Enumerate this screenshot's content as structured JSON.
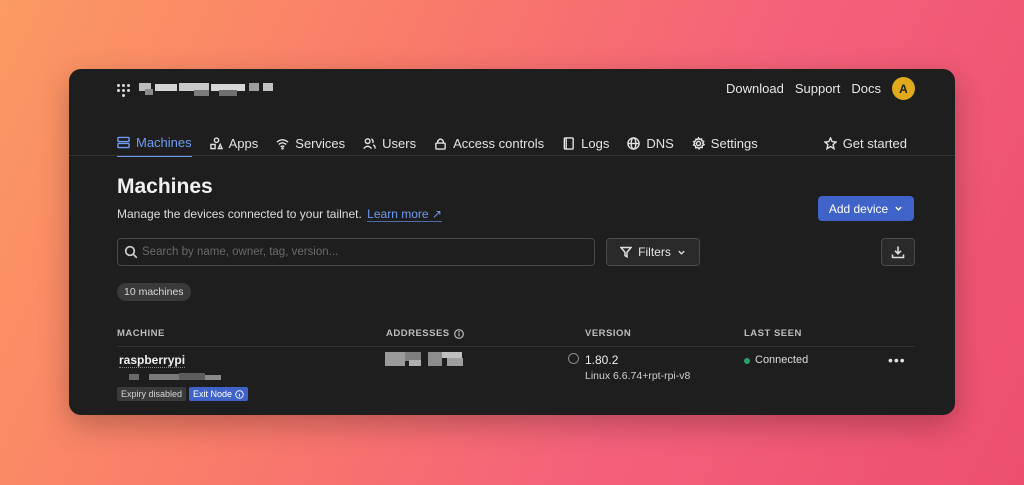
{
  "topbar": {
    "links": [
      "Download",
      "Support",
      "Docs"
    ],
    "avatar_initial": "A",
    "avatar_color": "#e0aa1c"
  },
  "nav": {
    "items": [
      {
        "label": "Machines",
        "icon": "server-icon",
        "active": true
      },
      {
        "label": "Apps",
        "icon": "apps-icon"
      },
      {
        "label": "Services",
        "icon": "wifi-icon"
      },
      {
        "label": "Users",
        "icon": "users-icon"
      },
      {
        "label": "Access controls",
        "icon": "lock-icon"
      },
      {
        "label": "Logs",
        "icon": "book-icon"
      },
      {
        "label": "DNS",
        "icon": "globe-icon"
      },
      {
        "label": "Settings",
        "icon": "gear-icon"
      }
    ],
    "get_started": "Get started"
  },
  "page": {
    "title": "Machines",
    "subtitle": "Manage the devices connected to your tailnet.",
    "learn_more": "Learn more ↗",
    "add_device": "Add device",
    "search_placeholder": "Search by name, owner, tag, version...",
    "filters": "Filters",
    "count": "10 machines"
  },
  "table": {
    "headers": {
      "machine": "MACHINE",
      "addresses": "ADDRESSES",
      "version": "VERSION",
      "last_seen": "LAST SEEN"
    },
    "rows": [
      {
        "name": "raspberrypi",
        "tags": [
          "Expiry disabled",
          "Exit Node"
        ],
        "version": "1.80.2",
        "os": "Linux 6.6.74+rpt-rpi-v8",
        "last_seen": "Connected",
        "status_color": "#26a36a"
      }
    ]
  },
  "colors": {
    "accent": "#6f9bf2",
    "primary_button": "#3f63c8"
  }
}
